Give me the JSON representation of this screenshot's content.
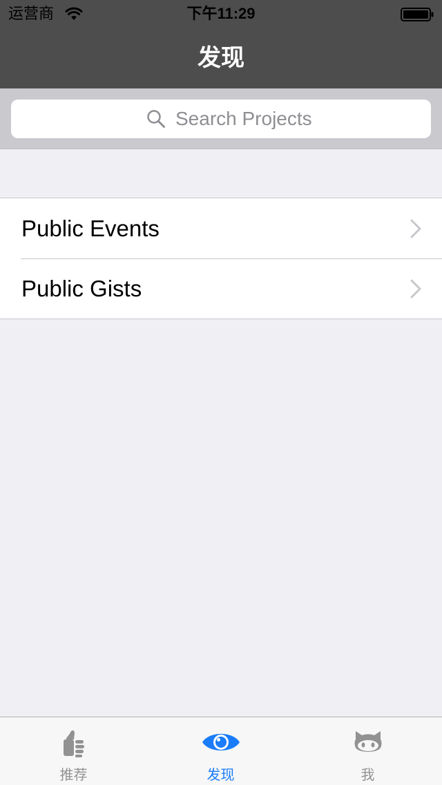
{
  "status_bar": {
    "carrier": "运营商",
    "time": "下午11:29"
  },
  "nav": {
    "title": "发现"
  },
  "search": {
    "placeholder": "Search Projects",
    "value": ""
  },
  "list": {
    "items": [
      {
        "label": "Public Events"
      },
      {
        "label": "Public Gists"
      }
    ]
  },
  "tabs": [
    {
      "label": "推荐",
      "icon": "thumbs-up-icon",
      "active": false
    },
    {
      "label": "发现",
      "icon": "eye-icon",
      "active": true
    },
    {
      "label": "我",
      "icon": "octocat-icon",
      "active": false
    }
  ],
  "colors": {
    "nav_background": "#4d4d4d",
    "accent": "#1a7cf9",
    "page_background": "#efeff4",
    "tab_inactive": "#929292"
  }
}
